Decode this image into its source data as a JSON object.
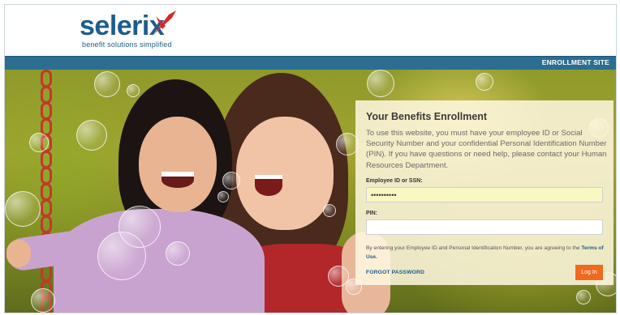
{
  "brand": {
    "logo_text": "selerix",
    "tagline": "benefit solutions simplified",
    "primary_color": "#1d5d8b",
    "accent_color": "#d7262a"
  },
  "nav": {
    "site_label": "ENROLLMENT SITE",
    "bar_color": "#2c6e91"
  },
  "login": {
    "title": "Your Benefits Enrollment",
    "intro": "To use this website, you must have your employee ID or Social Security Number and your confidential Personal Identification Number (PIN). If you have questions or need help, please contact your Human Resources Department.",
    "employee_id_label": "Employee ID or SSN:",
    "employee_id_value": "••••••••••",
    "pin_label": "PIN:",
    "pin_value": "",
    "consent_text": "By entering your Employee ID and Personal Identification Number, you are agreeing to the ",
    "terms_link": "Terms of Use.",
    "forgot_password": "FORGOT PASSWORD",
    "login_button": "Log In",
    "button_color": "#ee6a1f"
  },
  "hero": {
    "image": "smiling-mother-and-daughter-photo"
  }
}
